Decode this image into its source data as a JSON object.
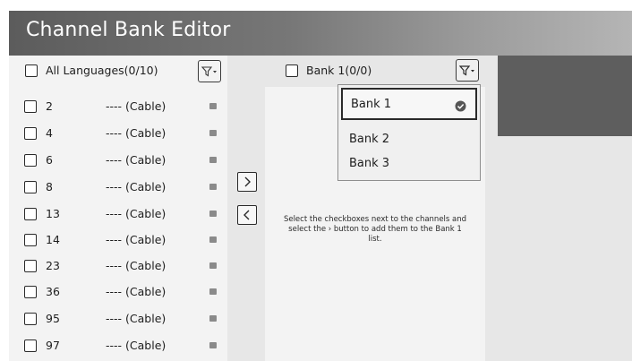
{
  "title": "Channel Bank Editor",
  "left_panel": {
    "select_all_label": "All Languages(0/10)",
    "filter_icon": "filter-icon",
    "channels": [
      {
        "number": "2",
        "name": "---- (Cable)"
      },
      {
        "number": "4",
        "name": "---- (Cable)"
      },
      {
        "number": "6",
        "name": "---- (Cable)"
      },
      {
        "number": "8",
        "name": "---- (Cable)"
      },
      {
        "number": "13",
        "name": "---- (Cable)"
      },
      {
        "number": "14",
        "name": "---- (Cable)"
      },
      {
        "number": "23",
        "name": "---- (Cable)"
      },
      {
        "number": "36",
        "name": "---- (Cable)"
      },
      {
        "number": "95",
        "name": "---- (Cable)"
      },
      {
        "number": "97",
        "name": "---- (Cable)"
      }
    ]
  },
  "transfer": {
    "add_icon": "chevron-right-icon",
    "remove_icon": "chevron-left-icon"
  },
  "right_panel": {
    "select_all_label": "Bank 1(0/0)",
    "filter_icon": "filter-icon",
    "hint_text": "Select the checkboxes next to the channels and select the › button to add them to the Bank 1 list."
  },
  "bank_dropdown": {
    "options": [
      "Bank 1",
      "Bank 2",
      "Bank 3"
    ],
    "selected": "Bank 1"
  },
  "colors": {
    "title_gradient_start": "#5c5c5c",
    "title_gradient_end": "#b5b5b5",
    "panel_bg": "#f3f3f3",
    "strip_bg": "#e7e7e7",
    "dark_block": "#5e5e5e"
  }
}
